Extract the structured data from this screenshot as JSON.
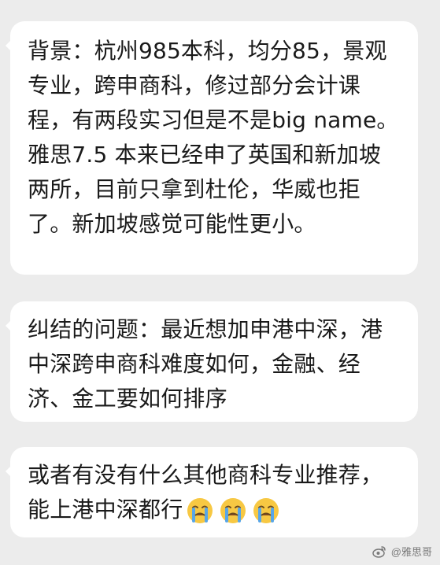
{
  "messages": [
    {
      "text": "背景：杭州985本科，均分85，景观专业，跨申商科，修过部分会计课程，有两段实习但是不是big name。雅思7.5 本来已经申了英国和新加坡两所，目前只拿到杜伦，华威也拒了。新加坡感觉可能性更小。"
    },
    {
      "text": "纠结的问题：最近想加申港中深，港中深跨申商科难度如何，金融、经济、金工要如何排序"
    },
    {
      "text": "或者有没有什么其他商科专业推荐，能上港中深都行",
      "emoji": [
        "crying-face-icon",
        "crying-face-icon",
        "crying-face-icon"
      ]
    }
  ],
  "watermark": {
    "text": "@雅思哥"
  },
  "colors": {
    "background": "#ececec",
    "bubble": "#ffffff",
    "text": "#1a1a1a",
    "emoji_face": "#f7c843",
    "emoji_tears": "#58a6e8"
  }
}
